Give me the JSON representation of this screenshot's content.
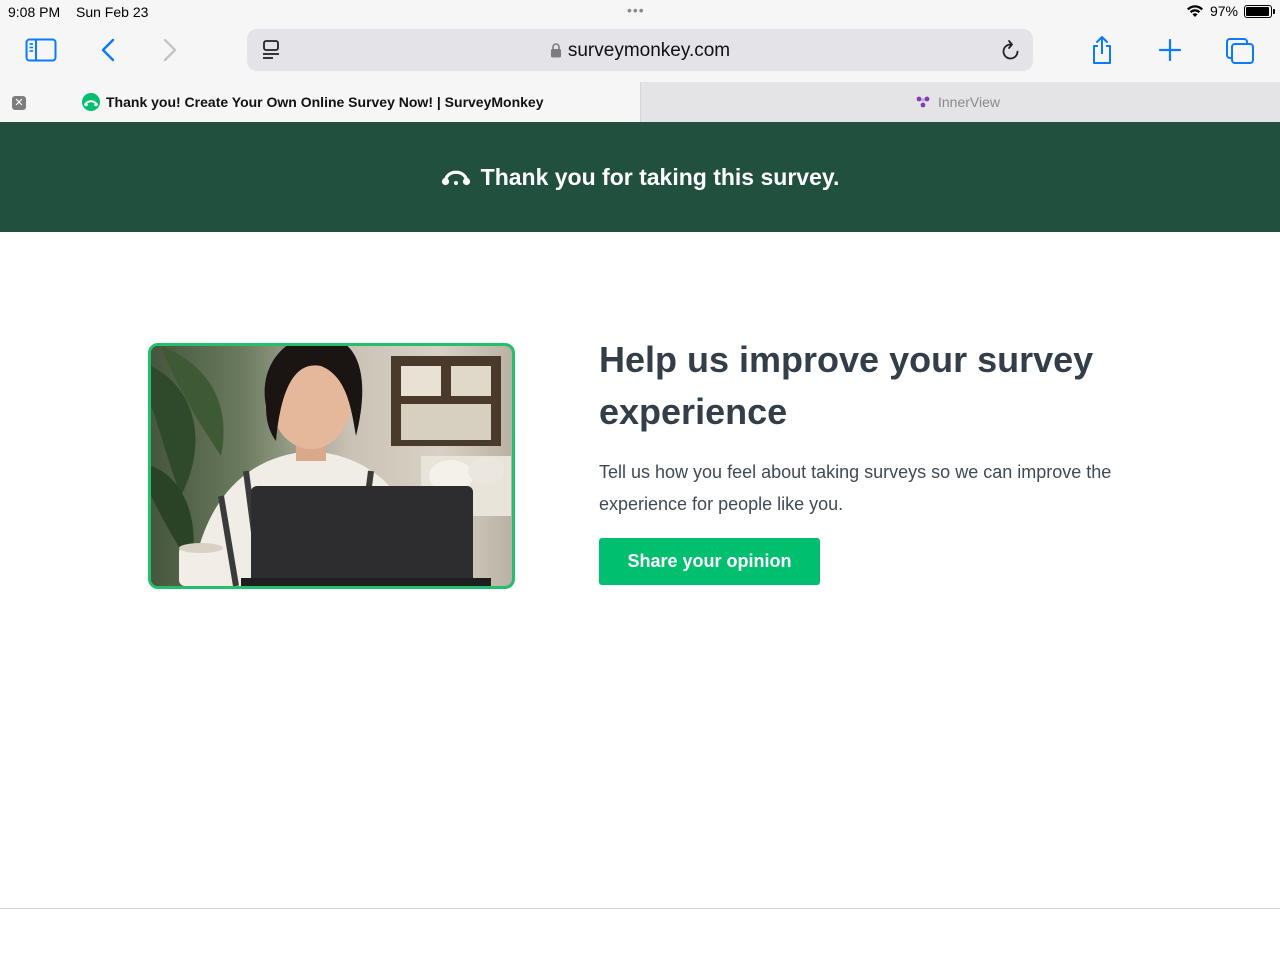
{
  "status_bar": {
    "time": "9:08 PM",
    "date": "Sun Feb 23",
    "battery": "97%"
  },
  "browser": {
    "url": "surveymonkey.com",
    "tabs": [
      {
        "title": "Thank you! Create Your Own Online Survey Now! | SurveyMonkey",
        "active": true
      },
      {
        "title": "InnerView",
        "active": false
      }
    ],
    "accent": "#0a7aff"
  },
  "banner": {
    "text": "Thank you for taking this survey.",
    "color": "#21513e"
  },
  "promo": {
    "headline": "Help us improve your survey experience",
    "description": "Tell us how you feel about taking surveys so we can improve the experience for people like you.",
    "button_label": "Share your opinion",
    "button_color": "#00bf6f",
    "image_border_color": "#22bf6d"
  }
}
